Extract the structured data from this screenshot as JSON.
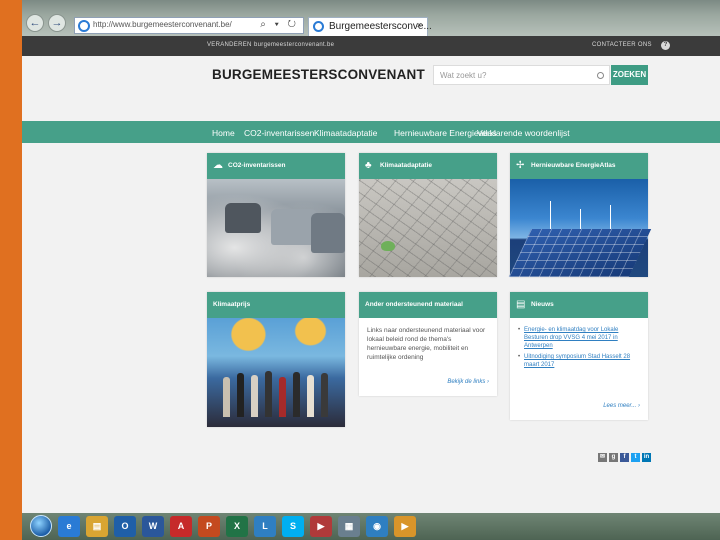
{
  "browser": {
    "url": "http://www.burgemeesterconvenant.be/",
    "tab_title": "Burgemeestersconve...",
    "tab_close": "×",
    "back": "←",
    "forward": "→",
    "addr_tools": "⌕ ▾ ↻"
  },
  "site": {
    "topbar": {
      "left_link": "VERANDEREN",
      "url_link": "burgemeesterconvenant.be",
      "contact": "CONTACTEER ONS",
      "help": "?"
    },
    "logo": "BURGEMEESTERSCONVENANT",
    "search": {
      "placeholder": "Wat zoekt u?",
      "button": "ZOEKEN"
    },
    "nav": [
      "Home",
      "CO2-inventarissen",
      "Klimaatadaptatie",
      "Hernieuwbare Energieatlas",
      "Verklarende woordenlijst"
    ],
    "cards": {
      "co2": {
        "title": "CO2-inventarissen",
        "icon": "cloud-icon"
      },
      "klimaat": {
        "title": "Klimaatadaptatie",
        "icon": "tree-icon"
      },
      "energie": {
        "title": "Hernieuwbare EnergieAtlas",
        "icon": "wind-turbine-icon"
      },
      "klimaatrijk": {
        "title": "Klimaatprijs"
      },
      "ander": {
        "title": "Ander ondersteunend materiaal",
        "body": "Links naar ondersteunend materiaal voor lokaal beleid rond de thema's hernieuwbare energie, mobiliteit en ruimtelijke ordening",
        "more": "Bekijk de links"
      },
      "nieuws": {
        "title": "Nieuws",
        "icon": "document-icon",
        "items": [
          "Energie- en klimaatdag voor Lokale Besturen drop VVSG 4 mei 2017 in Antwerpen",
          "Uitnodiging symposium Stad Hasselt 28 maart 2017"
        ],
        "more": "Lees meer..."
      }
    },
    "social": [
      "✉",
      "g",
      "f",
      "t",
      "in"
    ]
  },
  "taskbar": {
    "items": [
      {
        "name": "ie-taskbar-icon",
        "label": "e",
        "color": "#2a7bd5"
      },
      {
        "name": "file-explorer-taskbar-icon",
        "label": "▤",
        "color": "#d9a532"
      },
      {
        "name": "outlook-taskbar-icon",
        "label": "O",
        "color": "#1f5fa8"
      },
      {
        "name": "word-taskbar-icon",
        "label": "W",
        "color": "#2b579a"
      },
      {
        "name": "acrobat-taskbar-icon",
        "label": "A",
        "color": "#c62a2a"
      },
      {
        "name": "powerpoint-taskbar-icon",
        "label": "P",
        "color": "#c44a1f"
      },
      {
        "name": "excel-taskbar-icon",
        "label": "X",
        "color": "#217346"
      },
      {
        "name": "lync-taskbar-icon",
        "label": "L",
        "color": "#2f7fc1"
      },
      {
        "name": "skype-taskbar-icon",
        "label": "S",
        "color": "#00aff0"
      },
      {
        "name": "media-taskbar-icon",
        "label": "▶",
        "color": "#b03a3a"
      },
      {
        "name": "calculator-taskbar-icon",
        "label": "▦",
        "color": "#6a7f8f"
      },
      {
        "name": "chrome-taskbar-icon",
        "label": "◉",
        "color": "#2f7fc1"
      },
      {
        "name": "media-player-taskbar-icon",
        "label": "▶",
        "color": "#d9952a"
      }
    ]
  }
}
